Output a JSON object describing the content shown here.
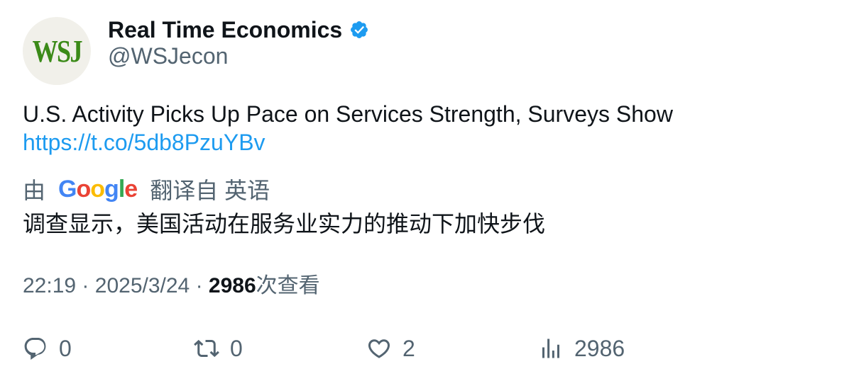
{
  "author": {
    "avatar_text": "WSJ",
    "display_name": "Real Time Economics",
    "handle": "@WSJecon",
    "verified_icon": "verified-badge-icon"
  },
  "tweet": {
    "text": "U.S. Activity Picks Up Pace on Services Strength, Surveys Show",
    "link": "https://t.co/5db8PzuYBv"
  },
  "translation": {
    "prefix": "由",
    "provider": "Google",
    "suffix": "翻译自 英语",
    "text": "调查显示，美国活动在服务业实力的推动下加快步伐"
  },
  "meta": {
    "time": "22:19",
    "separator": "·",
    "date": "2025/3/24",
    "views_count": "2986",
    "views_label": "次查看"
  },
  "actions": {
    "reply_count": "0",
    "retweet_count": "0",
    "like_count": "2",
    "views_count": "2986"
  },
  "colors": {
    "link": "#1d9bf0",
    "secondary_text": "#536471",
    "primary_text": "#0f1419",
    "verified": "#1d9bf0",
    "avatar_text": "#3b8a18"
  }
}
